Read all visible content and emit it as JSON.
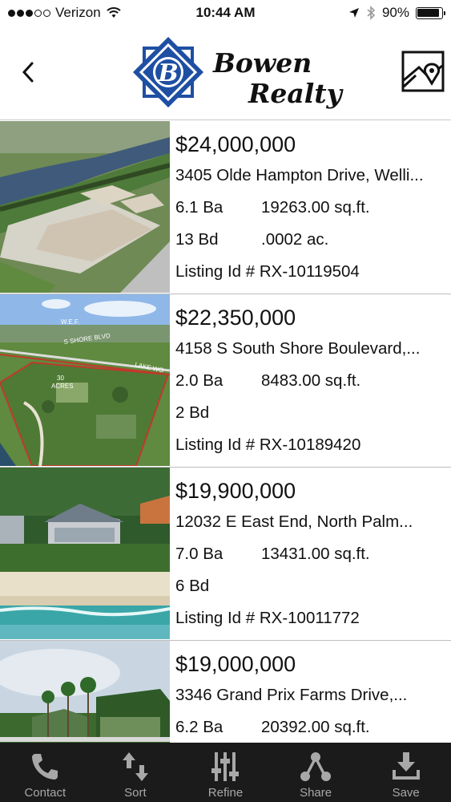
{
  "status_bar": {
    "carrier": "Verizon",
    "time": "10:44 AM",
    "battery": "90%",
    "battery_level": 0.9
  },
  "header": {
    "logo_line1": "Bowen",
    "logo_line2": "Realty",
    "logo_letter": "B",
    "back_icon": "chevron-left-icon",
    "map_icon": "map-pin-icon"
  },
  "listings": [
    {
      "price": "$24,000,000",
      "address": "3405 Olde Hampton Drive, Welli...",
      "baths": "6.1 Ba",
      "sqft": "19263.00 sq.ft.",
      "beds": "13 Bd",
      "acres": ".0002 ac.",
      "listing_id": "Listing Id # RX-10119504"
    },
    {
      "price": "$22,350,000",
      "address": "4158 S South Shore Boulevard,...",
      "baths": "2.0 Ba",
      "sqft": "8483.00 sq.ft.",
      "beds": "2 Bd",
      "acres": "",
      "listing_id": "Listing Id # RX-10189420",
      "photo_labels": {
        "wef": "W.E.F.",
        "road1": "S SHORE BLVD",
        "road2": "LAKE WO",
        "acres_num": "30",
        "acres_word": "ACRES"
      }
    },
    {
      "price": "$19,900,000",
      "address": "12032 E East End, North Palm...",
      "baths": "7.0 Ba",
      "sqft": "13431.00 sq.ft.",
      "beds": "6 Bd",
      "acres": "",
      "listing_id": "Listing Id # RX-10011772"
    },
    {
      "price": "$19,000,000",
      "address": "3346 Grand Prix Farms Drive,...",
      "baths": "6.2 Ba",
      "sqft": "20392.00 sq.ft.",
      "beds": "",
      "acres": "",
      "listing_id": ""
    }
  ],
  "tab_bar": [
    {
      "label": "Contact",
      "icon": "phone-icon"
    },
    {
      "label": "Sort",
      "icon": "sort-arrows-icon"
    },
    {
      "label": "Refine",
      "icon": "sliders-icon"
    },
    {
      "label": "Share",
      "icon": "share-icon"
    },
    {
      "label": "Save",
      "icon": "download-icon"
    }
  ],
  "colors": {
    "brand_blue": "#1e4fa3",
    "tab_bar_bg": "#1b1b1b",
    "tab_icon": "#a8a8a8"
  }
}
